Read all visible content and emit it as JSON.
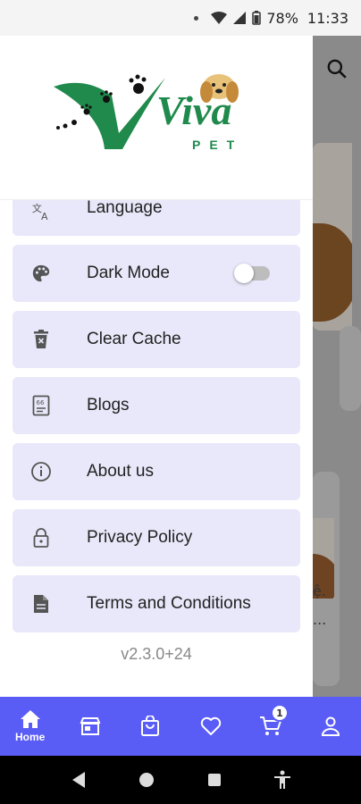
{
  "status_bar": {
    "battery": "78%",
    "time": "11:33"
  },
  "background": {
    "text_line1": "ệ.",
    "text_line2": "..."
  },
  "drawer": {
    "logo_text": "Viva",
    "logo_subtext": "PET",
    "menu": [
      {
        "label": "Language",
        "icon": "translate-icon"
      },
      {
        "label": "Dark Mode",
        "icon": "palette-icon",
        "toggle": false
      },
      {
        "label": "Clear Cache",
        "icon": "trash-icon"
      },
      {
        "label": "Blogs",
        "icon": "blog-icon"
      },
      {
        "label": "About us",
        "icon": "info-icon"
      },
      {
        "label": "Privacy Policy",
        "icon": "lock-icon"
      },
      {
        "label": "Terms and Conditions",
        "icon": "document-icon"
      }
    ],
    "version": "v2.3.0+24"
  },
  "bottom_nav": {
    "items": [
      {
        "label": "Home",
        "icon": "home-icon",
        "active": true
      },
      {
        "label": "",
        "icon": "store-icon"
      },
      {
        "label": "",
        "icon": "shopping-bag-icon"
      },
      {
        "label": "",
        "icon": "heart-icon"
      },
      {
        "label": "",
        "icon": "cart-icon",
        "badge": "1"
      },
      {
        "label": "",
        "icon": "person-icon"
      }
    ]
  },
  "colors": {
    "accent": "#5a5cf6",
    "menu_bg": "#e8e8fa",
    "logo_green": "#1f8a4c"
  }
}
